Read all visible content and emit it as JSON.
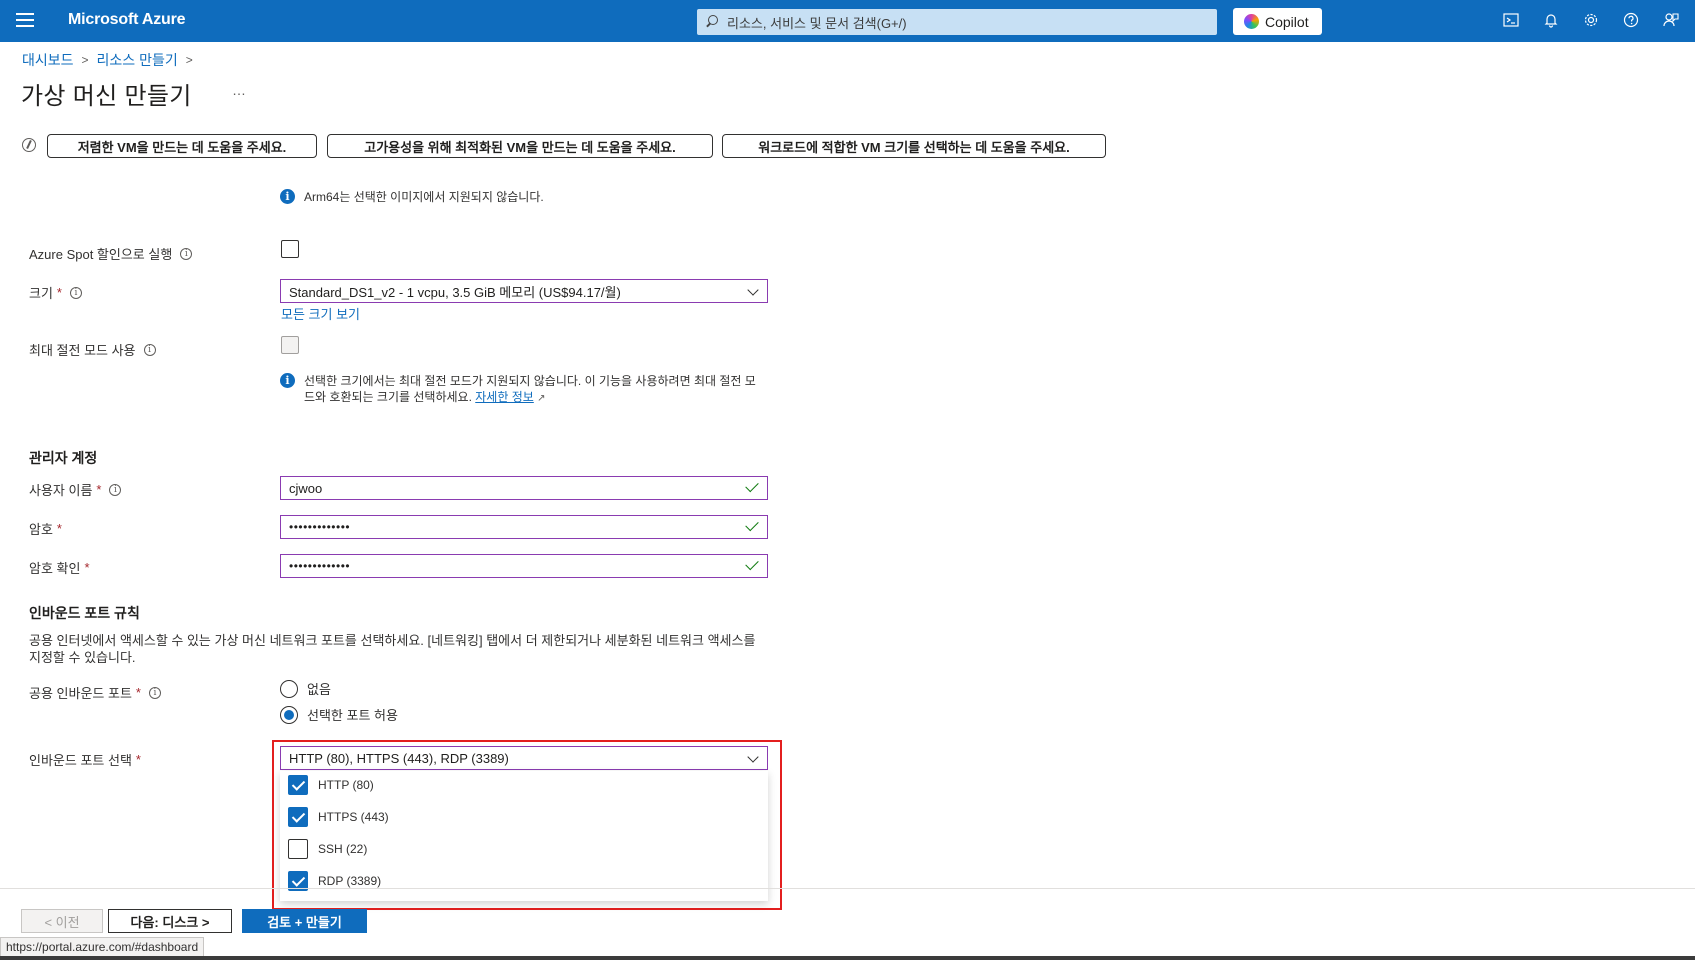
{
  "topbar": {
    "brand": "Microsoft Azure",
    "search_placeholder": "리소스, 서비스 및 문서 검색(G+/)",
    "copilot_label": "Copilot"
  },
  "breadcrumb": [
    "대시보드",
    "리소스 만들기"
  ],
  "page": {
    "title": "가상 머신 만들기",
    "more": "…"
  },
  "suggestions": [
    "저렴한 VM을 만드는 데 도움을 주세요.",
    "고가용성을 위해 최적화된 VM을 만드는 데 도움을 주세요.",
    "워크로드에 적합한 VM 크기를 선택하는 데 도움을 주세요."
  ],
  "form": {
    "arm_note": "Arm64는 선택한 이미지에서 지원되지 않습니다.",
    "spot_label": "Azure Spot 할인으로 실행",
    "size_label": "크기",
    "size_value": "Standard_DS1_v2 - 1 vcpu, 3.5 GiB 메모리 (US$94.17/월)",
    "all_sizes_link": "모든 크기 보기",
    "hibernate_label": "최대 절전 모드 사용",
    "hibernate_note": "선택한 크기에서는 최대 절전 모드가 지원되지 않습니다. 이 기능을 사용하려면 최대 절전 모드와 호환되는 크기를 선택하세요.",
    "learn_more": "자세한 정보",
    "admin_section": "관리자 계정",
    "username_label": "사용자 이름",
    "username_value": "cjwoo",
    "password_label": "암호",
    "password_value": "•••••••••••••",
    "confirm_label": "암호 확인",
    "confirm_value": "•••••••••••••",
    "inbound_section": "인바운드 포트 규칙",
    "inbound_desc": "공용 인터넷에서 액세스할 수 있는 가상 머신 네트워크 포트를 선택하세요. [네트워킹] 탭에서 더 제한되거나 세분화된 네트워크 액세스를 지정할 수 있습니다.",
    "public_ports_label": "공용 인바운드 포트",
    "radio_none": "없음",
    "radio_allow": "선택한 포트 허용",
    "select_ports_label": "인바운드 포트 선택",
    "select_ports_value": "HTTP (80), HTTPS (443), RDP (3389)",
    "required_mark": "*"
  },
  "port_options": [
    {
      "label": "HTTP (80)",
      "checked": true
    },
    {
      "label": "HTTPS (443)",
      "checked": true
    },
    {
      "label": "SSH (22)",
      "checked": false
    },
    {
      "label": "RDP (3389)",
      "checked": true
    }
  ],
  "footer": {
    "prev": "< 이전",
    "next": "다음: 디스크 >",
    "review": "검토 + 만들기",
    "status_url": "https://portal.azure.com/#dashboard"
  },
  "colors": {
    "accent": "#0f6cbd",
    "highlight": "#e31f1f",
    "success": "#107c10"
  }
}
